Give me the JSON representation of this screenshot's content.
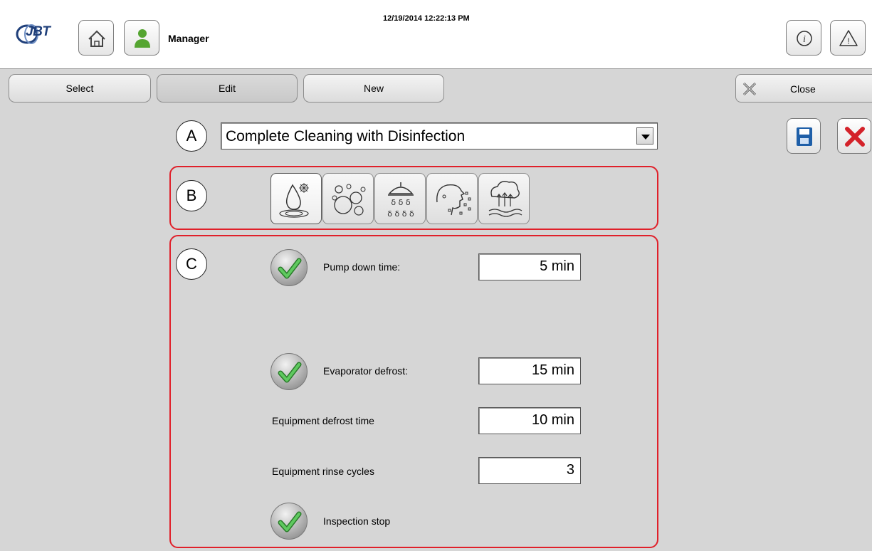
{
  "header": {
    "logo_text": "JBT",
    "user_name": "Manager",
    "datetime": "12/19/2014 12:22:13 PM"
  },
  "tabs": {
    "select": "Select",
    "edit": "Edit",
    "new": "New",
    "close": "Close"
  },
  "markers": {
    "a": "A",
    "b": "B",
    "c": "C"
  },
  "program": {
    "selected": "Complete Cleaning with Disinfection"
  },
  "steps": [
    "defrost-drop-icon",
    "foam-bubbles-icon",
    "rinse-shower-icon",
    "disinfect-spray-icon",
    "dry-steam-icon"
  ],
  "params": {
    "pump_down_label": "Pump down time:",
    "pump_down_value": "5 min",
    "evap_defrost_label": "Evaporator defrost:",
    "evap_defrost_value": "15 min",
    "equip_defrost_label": "Equipment defrost time",
    "equip_defrost_value": "10 min",
    "rinse_cycles_label": "Equipment rinse cycles",
    "rinse_cycles_value": "3",
    "inspection_label": "Inspection stop"
  },
  "colors": {
    "accent_red": "#e0202a",
    "check_green": "#3aa53a",
    "brand_blue": "#1f3f7a"
  }
}
